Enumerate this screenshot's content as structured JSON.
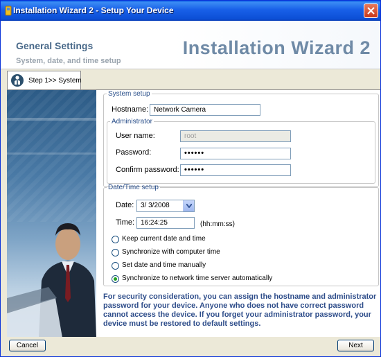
{
  "window": {
    "title": "Installation Wizard 2 - Setup Your Device"
  },
  "header": {
    "title": "General Settings",
    "subtitle": "System, date, and time setup",
    "brand": "Installation Wizard 2"
  },
  "tab": {
    "label": "Step 1>> System"
  },
  "system_setup": {
    "legend": "System setup",
    "hostname_label": "Hostname:",
    "hostname_value": "Network Camera"
  },
  "administrator": {
    "legend": "Administrator",
    "username_label": "User name:",
    "username_value": "root",
    "password_label": "Password:",
    "password_value": "••••••",
    "confirm_label": "Confirm password:",
    "confirm_value": "••••••"
  },
  "datetime": {
    "legend": "Date/Time setup",
    "date_label": "Date:",
    "date_value": "3/ 3/2008",
    "time_label": "Time:",
    "time_value": "16:24:25",
    "time_hint": "(hh:mm:ss)",
    "options": [
      {
        "label": "Keep current date and time",
        "checked": false
      },
      {
        "label": "Synchronize with computer time",
        "checked": false
      },
      {
        "label": "Set date and time manually",
        "checked": false
      },
      {
        "label": "Synchronize to network time server automatically",
        "checked": true
      }
    ]
  },
  "notice": "For security consideration, you can assign the hostname and administrator password for your device. Anyone who does not have correct password cannot access the device. If you forget your administrator password, your device must be restored to default settings.",
  "buttons": {
    "cancel": "Cancel",
    "next": "Next"
  }
}
